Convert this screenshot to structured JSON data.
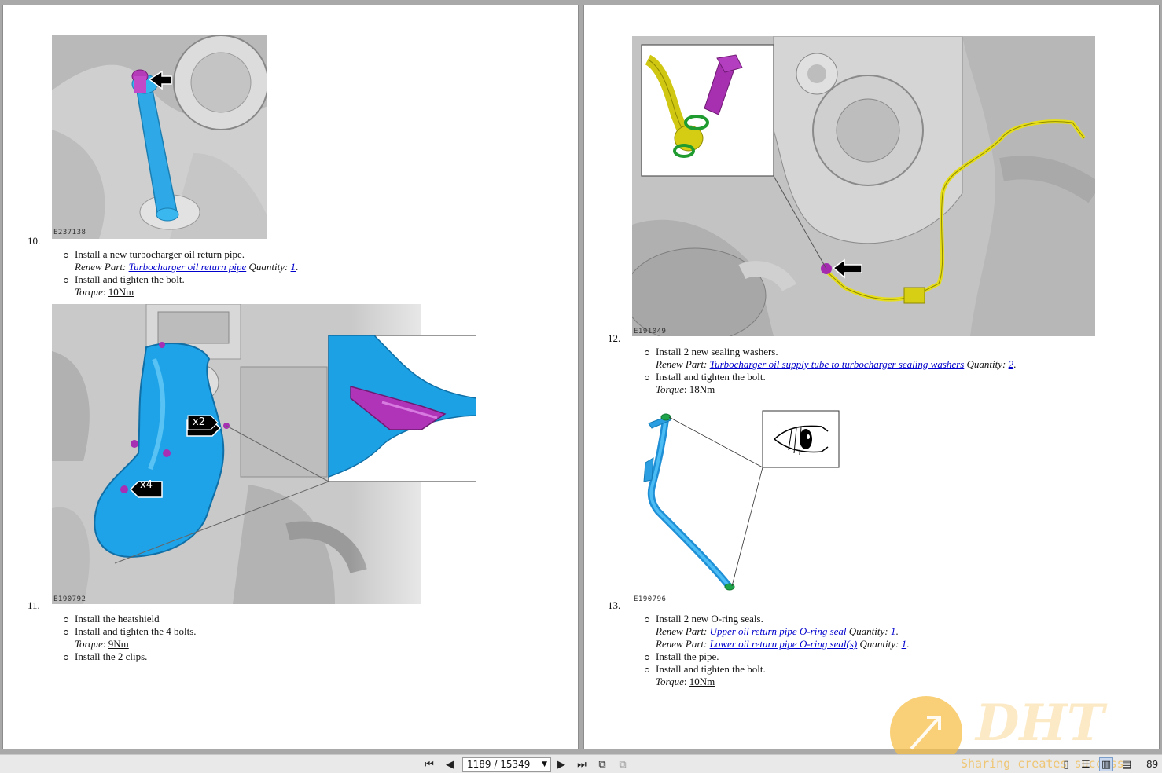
{
  "viewer": {
    "page_indicator": "1189 / 15349",
    "zoom_partial": "89"
  },
  "watermark": {
    "logo": "DHT",
    "tagline": "Sharing creates success"
  },
  "left_page": {
    "step10": {
      "number": "10.",
      "figure_code": "E237138",
      "lines": [
        "Install a new turbocharger oil return pipe.",
        "Install and tighten the bolt."
      ],
      "renew_label": "Renew Part:",
      "renew_part": "Turbocharger oil return pipe",
      "quantity_label": "Quantity:",
      "quantity": "1",
      "torque_label": "Torque",
      "torque": "10Nm"
    },
    "step11": {
      "number": "11.",
      "figure_code": "E190792",
      "callout_x2": "x2",
      "callout_x4": "x4",
      "lines": [
        "Install the heatshield",
        "Install and tighten the 4 bolts.",
        "Install the 2 clips."
      ],
      "torque_label": "Torque",
      "torque": "9Nm"
    }
  },
  "right_page": {
    "step12": {
      "number": "12.",
      "figure_code": "E191049",
      "lines": [
        "Install 2 new sealing washers.",
        "Install and tighten the bolt."
      ],
      "renew_label": "Renew Part:",
      "renew_part": "Turbocharger oil supply tube to turbocharger sealing washers",
      "quantity_label": "Quantity:",
      "quantity": "2",
      "torque_label": "Torque",
      "torque": "18Nm"
    },
    "step13": {
      "number": "13.",
      "figure_code": "E190796",
      "lines": [
        "Install 2 new O-ring seals.",
        "Install the pipe.",
        "Install and tighten the bolt."
      ],
      "renew_label": "Renew Part:",
      "renew_part_1": "Upper oil return pipe O-ring seal",
      "quantity_1": "1",
      "renew_part_2": "Lower oil return pipe O-ring seal(s)",
      "quantity_2": "1",
      "quantity_label": "Quantity:",
      "torque_label": "Torque",
      "torque": "10Nm"
    }
  }
}
